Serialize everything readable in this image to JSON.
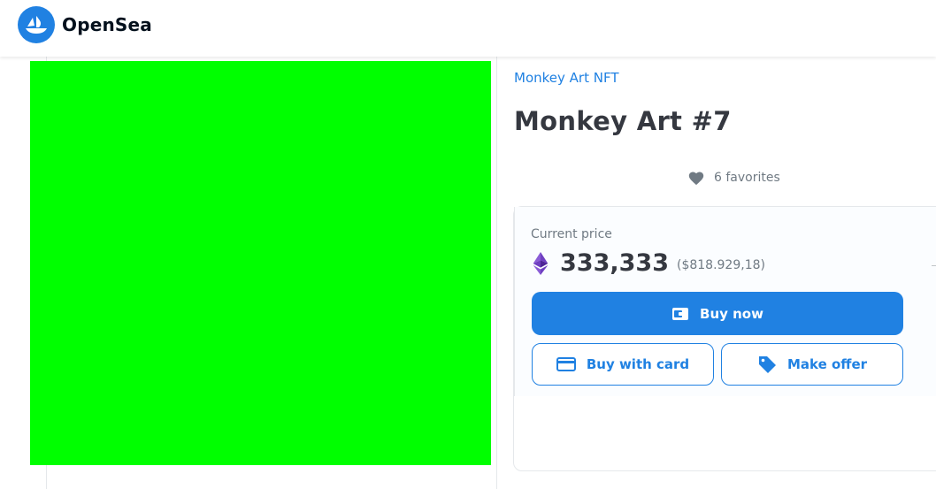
{
  "header": {
    "logo_text": "OpenSea",
    "logo_icon": "opensea-ship-icon"
  },
  "item": {
    "collection_name": "Monkey Art NFT",
    "title": "Monkey Art #7",
    "favorites_text": "6 favorites",
    "image_color": "#00ff00"
  },
  "pricing": {
    "label": "Current price",
    "currency_icon": "ethereum-icon",
    "price": "333,333",
    "usd_price": "($818.929,18)"
  },
  "actions": {
    "buy_now_label": "Buy now",
    "buy_with_card_label": "Buy with card",
    "make_offer_label": "Make offer"
  },
  "colors": {
    "accent": "#2081e2",
    "text_primary": "#353840",
    "text_secondary": "#707a83"
  }
}
